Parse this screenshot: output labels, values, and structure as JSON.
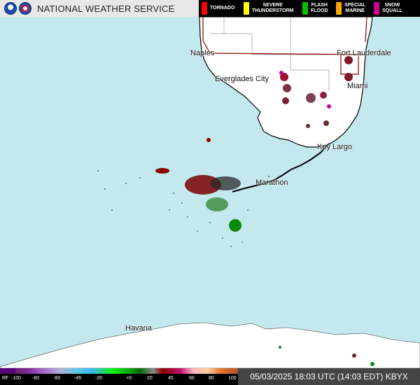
{
  "header": {
    "title": "NATIONAL WEATHER SERVICE",
    "logos": [
      "noaa-logo",
      "nws-logo"
    ]
  },
  "legend": [
    {
      "label": "TORNADO",
      "color": "#ff0000"
    },
    {
      "label": "SEVERE\nTHUNDERSTORM",
      "color": "#ffff00"
    },
    {
      "label": "FLASH\nFLOOD",
      "color": "#00c000"
    },
    {
      "label": "SPECIAL\nMARINE",
      "color": "#ffa500"
    },
    {
      "label": "SNOW\nSQUALL",
      "color": "#cc0099"
    }
  ],
  "cities": {
    "naples": "Naples",
    "fort_lauderdale": "Fort Lauderdale",
    "everglades_city": "Everglades City",
    "miami": "Miami",
    "key_largo": "Key Largo",
    "marathon": "Marathon",
    "havana": "Havana"
  },
  "scale": {
    "rf": "RF",
    "ticks": [
      "-100",
      "-80",
      "-60",
      "-45",
      "-20",
      "+0",
      "20",
      "45",
      "60",
      "80",
      "100"
    ]
  },
  "timestamp": "05/03/2025 18:03 UTC (14:03 EDT) KBYX",
  "colors": {
    "ocean": "#c3e8ee",
    "land": "#ffffff",
    "county_line": "#9a9a9a",
    "state_road": "#8b0000",
    "coast": "#000000"
  }
}
